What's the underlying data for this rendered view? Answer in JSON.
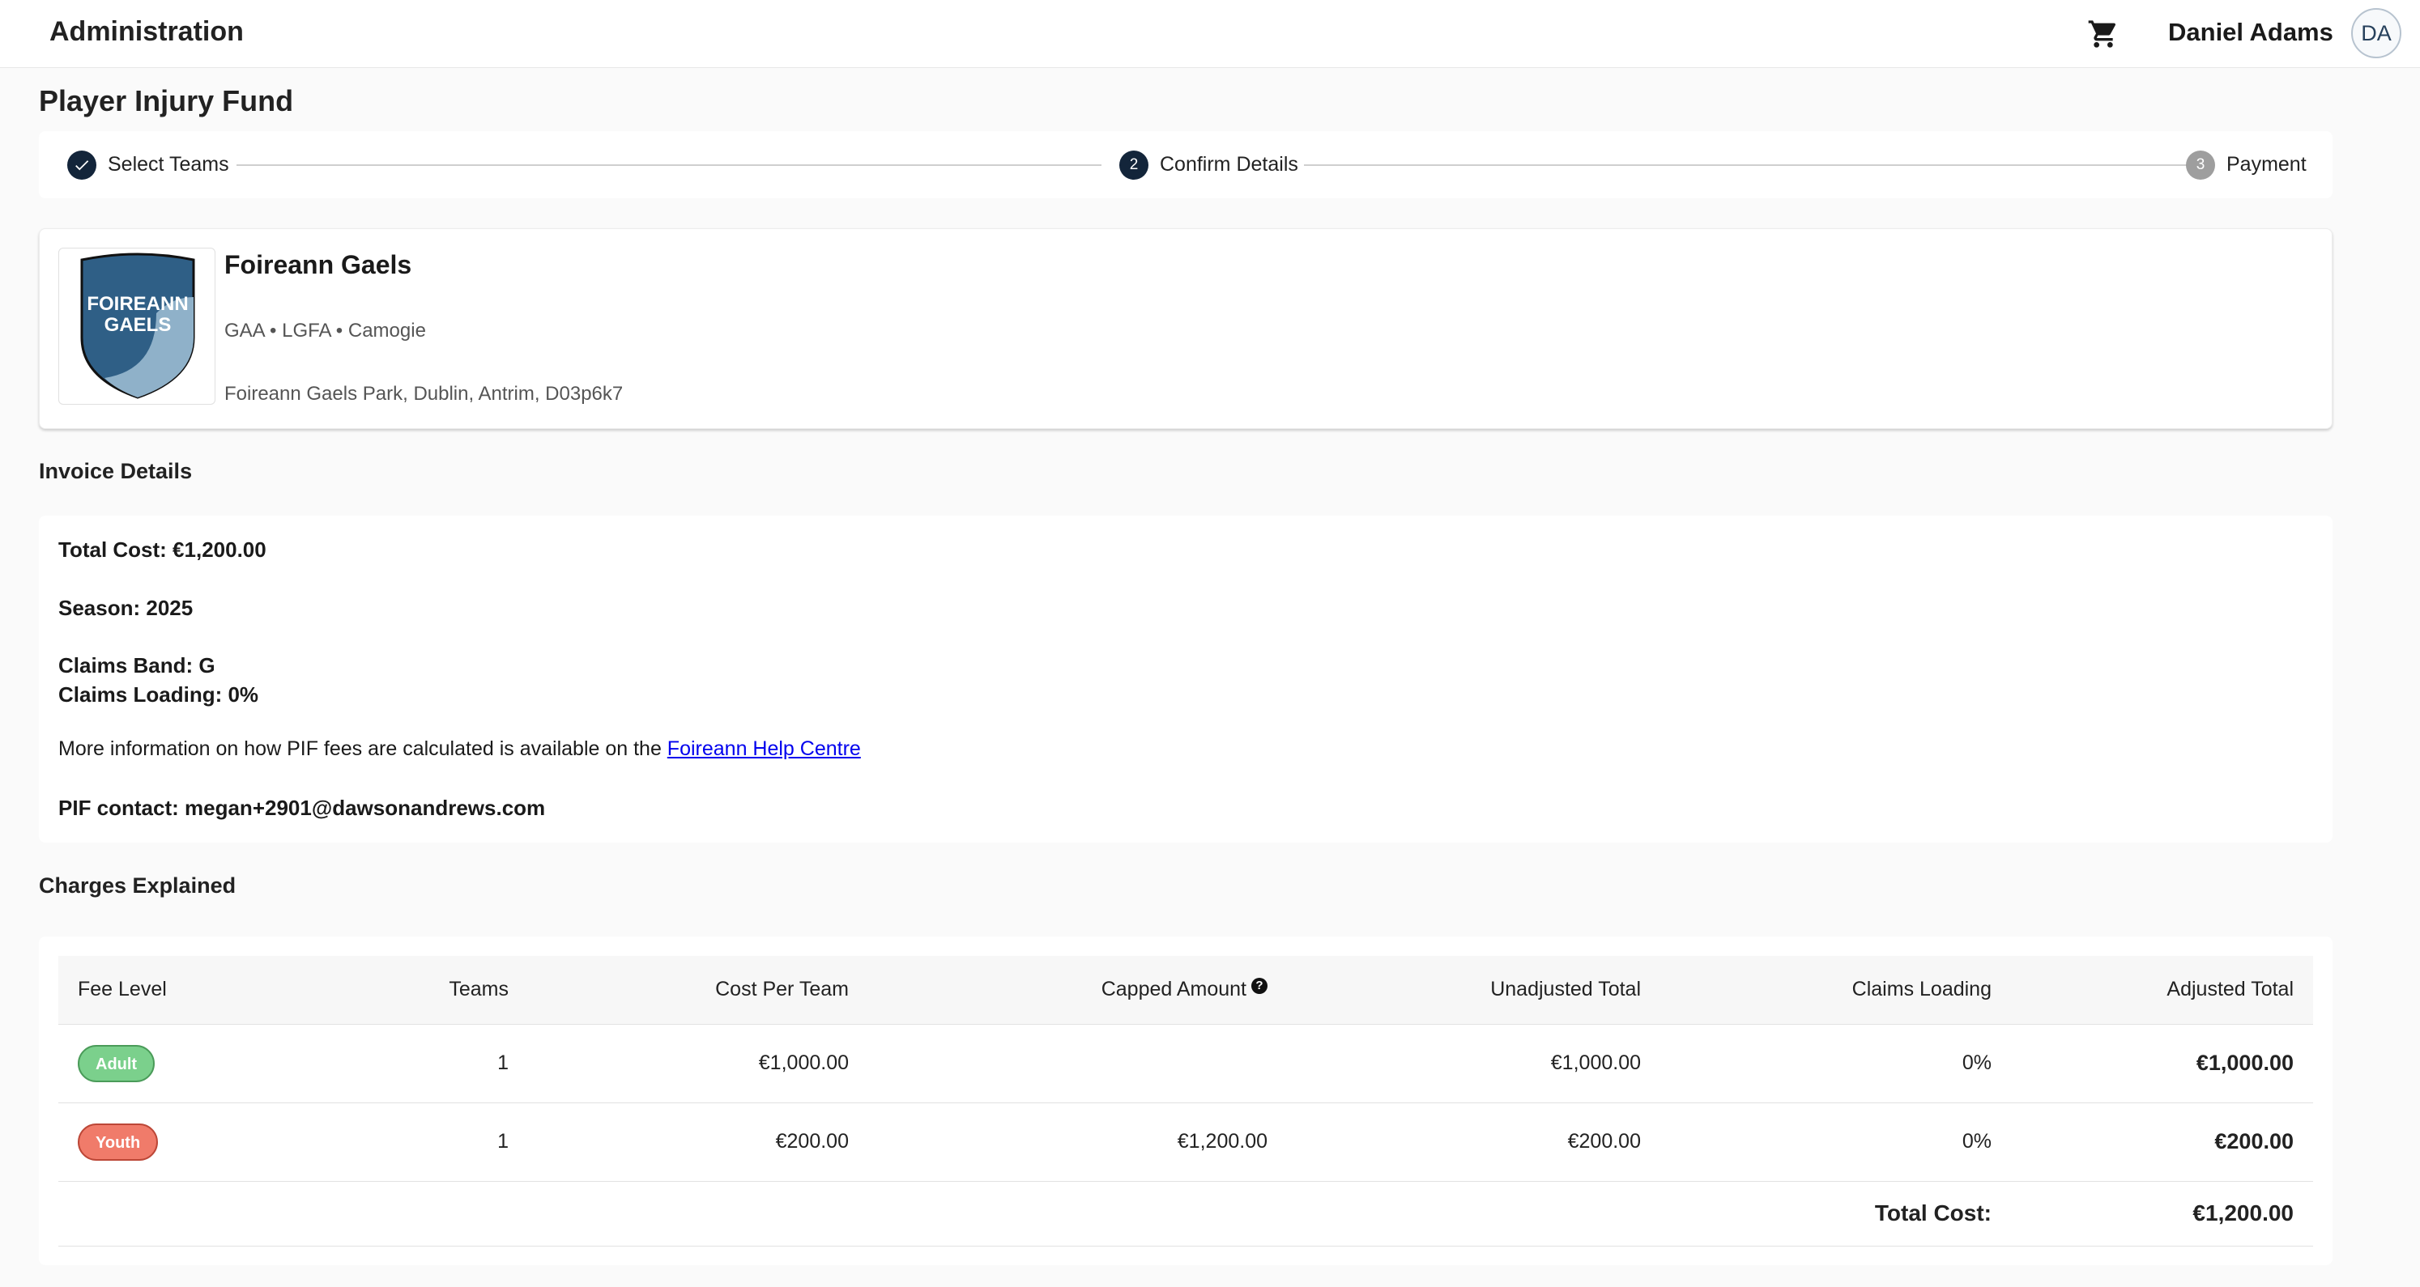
{
  "appbar": {
    "title": "Administration",
    "cart_icon": "shopping-cart-icon",
    "user_name": "Daniel Adams",
    "avatar_initials": "DA"
  },
  "page": {
    "title": "Player Injury Fund"
  },
  "stepper": {
    "steps": [
      {
        "label": "Select Teams",
        "number": "1",
        "state": "completed"
      },
      {
        "label": "Confirm Details",
        "number": "2",
        "state": "active"
      },
      {
        "label": "Payment",
        "number": "3",
        "state": "pending"
      }
    ]
  },
  "club": {
    "name": "Foireann Gaels",
    "codes": "GAA • LGFA • Camogie",
    "address": "Foireann Gaels Park, Dublin, Antrim, D03p6k7",
    "crest_text_line1": "FOIREANN",
    "crest_text_line2": "GAELS",
    "crest_colors": {
      "primary": "#2f5f86",
      "secondary": "#8fb1c9"
    }
  },
  "invoice": {
    "heading": "Invoice Details",
    "total_cost": "Total Cost: €1,200.00",
    "season": "Season: 2025",
    "claims_band": "Claims Band: G",
    "claims_loading": "Claims Loading: 0%",
    "info_text": "More information on how PIF fees are calculated is available on the ",
    "info_link": "Foireann Help Centre",
    "pif_contact": "PIF contact: megan+2901@dawsonandrews.com"
  },
  "charges": {
    "heading": "Charges Explained",
    "columns": [
      "Fee Level",
      "Teams",
      "Cost Per Team",
      "Capped Amount",
      "Unadjusted Total",
      "Claims Loading",
      "Adjusted Total"
    ],
    "capped_help_icon": "question-circle-icon",
    "rows": [
      {
        "fee_level": "Adult",
        "teams": "1",
        "cost_per_team": "€1,000.00",
        "capped_amount": "",
        "unadjusted_total": "€1,000.00",
        "claims_loading": "0%",
        "adjusted_total": "€1,000.00"
      },
      {
        "fee_level": "Youth",
        "teams": "1",
        "cost_per_team": "€200.00",
        "capped_amount": "€1,200.00",
        "unadjusted_total": "€200.00",
        "claims_loading": "0%",
        "adjusted_total": "€200.00"
      }
    ],
    "total_label": "Total Cost:",
    "total_value": "€1,200.00"
  },
  "colors": {
    "adult_chip": "#7bd08c",
    "youth_chip": "#f07b6a",
    "step_active": "#13253a",
    "step_pending": "#9e9e9e",
    "link": "#0000ee"
  }
}
